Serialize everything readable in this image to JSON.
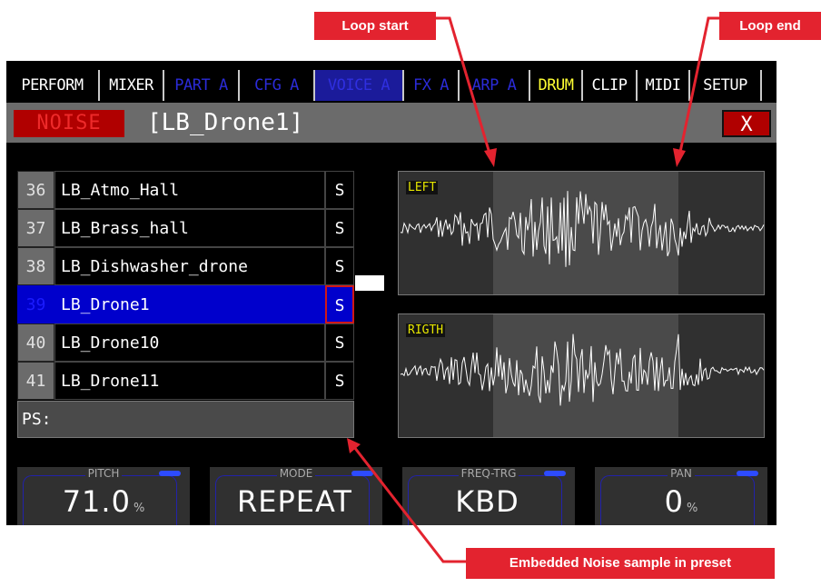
{
  "annotations": {
    "loop_start": "Loop start",
    "loop_end": "Loop end",
    "embedded": "Embedded Noise sample in preset"
  },
  "tabs": [
    {
      "label": "PERFORM",
      "style": "white"
    },
    {
      "label": "MIXER",
      "style": "white"
    },
    {
      "label": "PART A",
      "style": "blue"
    },
    {
      "label": "CFG A",
      "style": "blue"
    },
    {
      "label": "VOICE A",
      "style": "active"
    },
    {
      "label": "FX A",
      "style": "blue"
    },
    {
      "label": "ARP A",
      "style": "blue"
    },
    {
      "label": "DRUM",
      "style": "yellow"
    },
    {
      "label": "CLIP",
      "style": "white"
    },
    {
      "label": "MIDI",
      "style": "white"
    },
    {
      "label": "SETUP",
      "style": "white"
    }
  ],
  "header": {
    "mode_badge": "NOISE",
    "title": "[LB_Drone1]",
    "close_label": "X"
  },
  "samples": [
    {
      "num": "36",
      "name": "LB_Atmo_Hall",
      "flag": "S"
    },
    {
      "num": "37",
      "name": "LB_Brass_hall",
      "flag": "S"
    },
    {
      "num": "38",
      "name": "LB_Dishwasher_drone",
      "flag": "S"
    },
    {
      "num": "39",
      "name": "LB_Drone1",
      "flag": "S",
      "selected": true
    },
    {
      "num": "40",
      "name": "LB_Drone10",
      "flag": "S"
    },
    {
      "num": "41",
      "name": "LB_Drone11",
      "flag": "S"
    }
  ],
  "preset_sample_label": "PS:",
  "waveforms": {
    "left": {
      "label": "LEFT"
    },
    "right": {
      "label": "RIGTH"
    }
  },
  "params": [
    {
      "label": "PITCH",
      "value": "71.0",
      "unit": "%"
    },
    {
      "label": "MODE",
      "value": "REPEAT",
      "unit": ""
    },
    {
      "label": "FREQ-TRG",
      "value": "KBD",
      "unit": ""
    },
    {
      "label": "PAN",
      "value": "0",
      "unit": "%"
    }
  ],
  "colors": {
    "accent_red": "#e3232f",
    "selection_blue": "#0000cc",
    "tab_blue": "#2b2bd8",
    "drum_yellow": "#ffff33"
  }
}
